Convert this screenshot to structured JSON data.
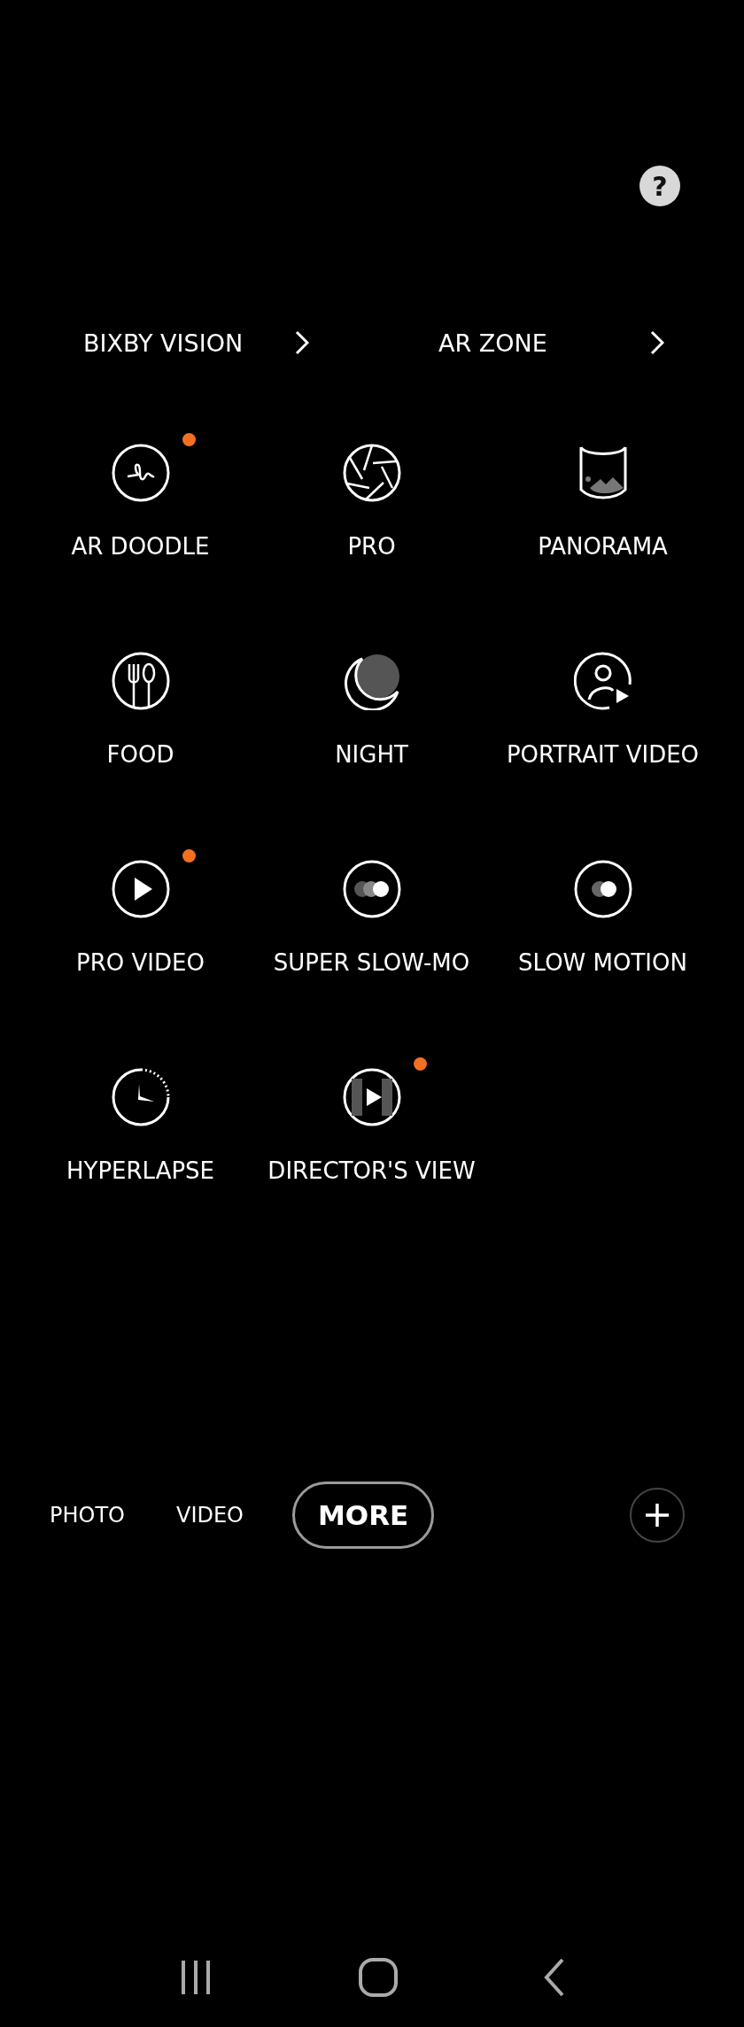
{
  "help_button": {
    "label": "?"
  },
  "links": [
    {
      "label": "BIXBY VISION"
    },
    {
      "label": "AR ZONE"
    }
  ],
  "modes": [
    {
      "label": "AR DOODLE",
      "new": true
    },
    {
      "label": "PRO",
      "new": false
    },
    {
      "label": "PANORAMA",
      "new": false
    },
    {
      "label": "FOOD",
      "new": false
    },
    {
      "label": "NIGHT",
      "new": false
    },
    {
      "label": "PORTRAIT VIDEO",
      "new": false
    },
    {
      "label": "PRO VIDEO",
      "new": true
    },
    {
      "label": "SUPER SLOW-MO",
      "new": false
    },
    {
      "label": "SLOW MOTION",
      "new": false
    },
    {
      "label": "HYPERLAPSE",
      "new": false
    },
    {
      "label": "DIRECTOR'S VIEW",
      "new": true
    }
  ],
  "mode_tabs": [
    {
      "label": "PHOTO",
      "selected": false
    },
    {
      "label": "VIDEO",
      "selected": false
    },
    {
      "label": "MORE",
      "selected": true
    }
  ]
}
